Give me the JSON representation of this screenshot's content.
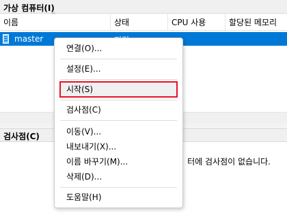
{
  "vm_panel": {
    "title": "가상 컴퓨터(I)",
    "sort_arrow": "^",
    "columns": [
      "이름",
      "상태",
      "CPU 사용",
      "할당된 메모리"
    ],
    "rows": [
      {
        "name": "master",
        "state": "꺼짐",
        "icon": "vm-icon",
        "selected": true
      }
    ]
  },
  "checkpoints_panel": {
    "title": "검사점(C)",
    "empty_text": "터에 검사점이 없습니다."
  },
  "context_menu": {
    "items": [
      {
        "label": "연결(O)..."
      },
      {
        "label": "설정(E)..."
      },
      {
        "label": "시작(S)",
        "highlighted": true
      },
      {
        "label": "검사점(C)"
      },
      {
        "label": "이동(V)..."
      },
      {
        "label": "내보내기(X)..."
      },
      {
        "label": "이름 바꾸기(M)..."
      },
      {
        "label": "삭제(D)..."
      },
      {
        "label": "도움말(H)"
      }
    ]
  },
  "colors": {
    "selection": "#0078d7",
    "menu_highlight": "#f0f0f0",
    "highlight_box": "#e81123",
    "header_bg": "#f0f0f0"
  }
}
